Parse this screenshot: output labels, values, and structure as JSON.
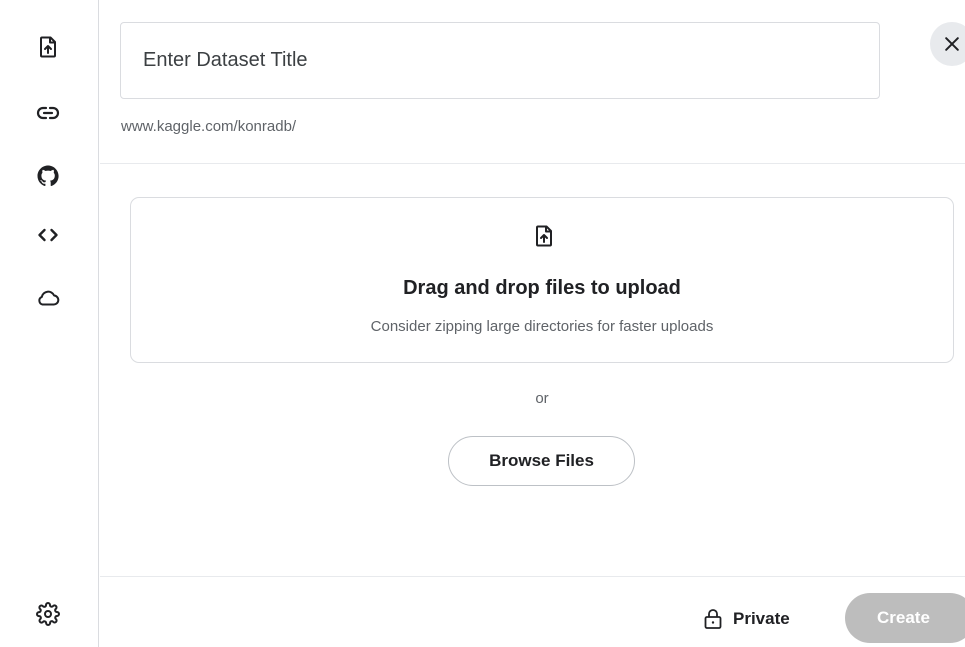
{
  "sidebar": {
    "items": [
      {
        "icon": "file-upload-icon"
      },
      {
        "icon": "link-icon"
      },
      {
        "icon": "github-icon"
      },
      {
        "icon": "code-icon"
      },
      {
        "icon": "cloud-icon"
      }
    ],
    "settings_icon": "gear-icon"
  },
  "form": {
    "title_placeholder": "Enter Dataset Title",
    "title_value": "",
    "url_prefix": "www.kaggle.com/konradb/"
  },
  "dropzone": {
    "icon": "file-upload-icon",
    "title": "Drag and drop files to upload",
    "subtitle": "Consider zipping large directories for faster uploads"
  },
  "or_label": "or",
  "browse_label": "Browse Files",
  "footer": {
    "privacy_label": "Private",
    "privacy_icon": "lock-icon",
    "create_label": "Create"
  },
  "colors": {
    "border": "#dadce0",
    "text_primary": "#202124",
    "text_secondary": "#5f6368",
    "create_disabled_bg": "#bdbdbd",
    "close_bg": "#e8eaed"
  }
}
